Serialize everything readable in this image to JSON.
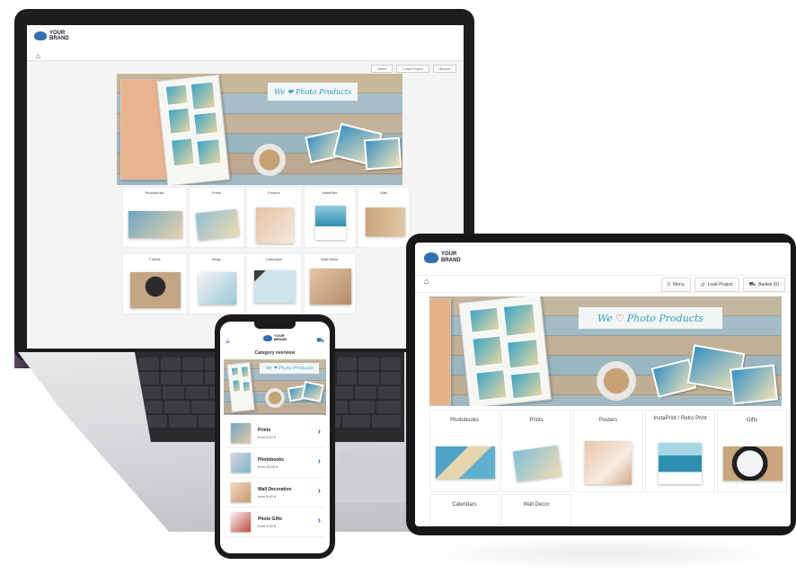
{
  "laptop": {
    "brand_line1": "YOUR",
    "brand_line2": "BRAND",
    "toolbar": [
      "Menu",
      "Load Project",
      "Basket"
    ],
    "banner_text": "We ❤ Photo Products",
    "categories": [
      {
        "label": "Photobooks"
      },
      {
        "label": "Prints"
      },
      {
        "label": "Posters"
      },
      {
        "label": "InstaPrint"
      },
      {
        "label": "Gifts"
      },
      {
        "label": "T-shirts"
      },
      {
        "label": "Mugs"
      },
      {
        "label": "Calendars"
      },
      {
        "label": "Wall Decor"
      }
    ]
  },
  "phone": {
    "brand_line1": "YOUR",
    "brand_line2": "BRAND",
    "title": "Category overview",
    "banner_text": "We ❤ Photo Products",
    "items": [
      {
        "name": "Prints",
        "price": "from 0,10 €"
      },
      {
        "name": "Photobooks",
        "price": "from 15,00 €"
      },
      {
        "name": "Wall Decoration",
        "price": "from 5,00 €"
      },
      {
        "name": "Photo Gifts",
        "price": "from 3,00 €"
      }
    ]
  },
  "tablet": {
    "brand_line1": "YOUR",
    "brand_line2": "BRAND",
    "menu_label": "Menu",
    "load_label": "Load Project",
    "basket_label": "Basket (0)",
    "banner_prefix": "We",
    "banner_suffix": "Photo Products",
    "categories": [
      {
        "label": "Photobooks"
      },
      {
        "label": "Prints"
      },
      {
        "label": "Posters"
      },
      {
        "label": "InstaPrint / Retro Print"
      },
      {
        "label": "Gifts"
      },
      {
        "label": "Calendars"
      },
      {
        "label": "Wall Décor"
      }
    ]
  },
  "colors": {
    "brand_blue": "#2f6fb3",
    "banner_teal": "#2aa3b8",
    "heart_red": "#e23c4d",
    "device_black": "#1b1b1d"
  },
  "icons": [
    "home-icon",
    "menu-icon",
    "load-project-icon",
    "cart-icon",
    "chevron-right-icon",
    "hamburger-icon",
    "brand-logo-icon"
  ]
}
